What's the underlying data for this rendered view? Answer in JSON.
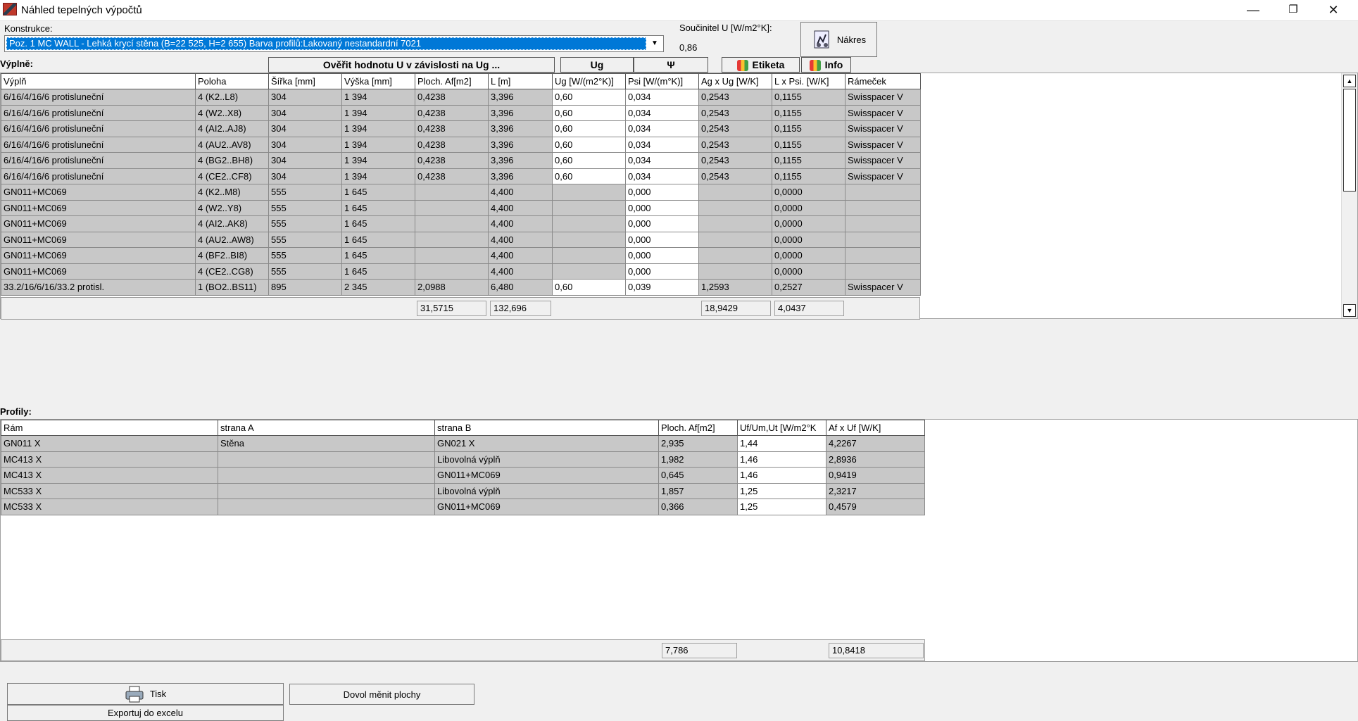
{
  "window": {
    "title": "Náhled tepelných výpočtů",
    "minimize": "—",
    "restore": "❐",
    "close": "✕"
  },
  "konstrukce": {
    "label": "Konstrukce:",
    "selected": "Poz. 1  MC WALL - Lehká krycí stěna (B=22 525, H=2 655) Barva profilů:Lakovaný nestandardní 7021"
  },
  "u_value": {
    "label": "Součinitel U [W/m2°K]:",
    "value": "0,86"
  },
  "buttons": {
    "nakres": "Nákres",
    "overit": "Ověřit hodnotu U v závislosti na Ug ...",
    "ug": "Ug",
    "psi": "Ψ",
    "etiketa": "Etiketa",
    "info": "Info",
    "tisk": "Tisk",
    "dovol": "Dovol měnit plochy",
    "export": "Exportuj do excelu"
  },
  "fills": {
    "section_label": "Výplně:",
    "columns": [
      "Výplň",
      "Poloha",
      "Šířka [mm]",
      "Výška [mm]",
      "Ploch. Af[m2]",
      "L [m]",
      "Ug [W/(m2°K)]",
      "Psi [W/(m°K)]",
      "Ag x Ug [W/K]",
      "L x Psi. [W/K]",
      "Rámeček"
    ],
    "rows": [
      [
        "6/16/4/16/6 protisluneční",
        "4 (K2..L8)",
        "304",
        "1 394",
        "0,4238",
        "3,396",
        "0,60",
        "0,034",
        "0,2543",
        "0,1155",
        "Swisspacer V"
      ],
      [
        "6/16/4/16/6 protisluneční",
        "4 (W2..X8)",
        "304",
        "1 394",
        "0,4238",
        "3,396",
        "0,60",
        "0,034",
        "0,2543",
        "0,1155",
        "Swisspacer V"
      ],
      [
        "6/16/4/16/6 protisluneční",
        "4 (AI2..AJ8)",
        "304",
        "1 394",
        "0,4238",
        "3,396",
        "0,60",
        "0,034",
        "0,2543",
        "0,1155",
        "Swisspacer V"
      ],
      [
        "6/16/4/16/6 protisluneční",
        "4 (AU2..AV8)",
        "304",
        "1 394",
        "0,4238",
        "3,396",
        "0,60",
        "0,034",
        "0,2543",
        "0,1155",
        "Swisspacer V"
      ],
      [
        "6/16/4/16/6 protisluneční",
        "4 (BG2..BH8)",
        "304",
        "1 394",
        "0,4238",
        "3,396",
        "0,60",
        "0,034",
        "0,2543",
        "0,1155",
        "Swisspacer V"
      ],
      [
        "6/16/4/16/6 protisluneční",
        "4 (CE2..CF8)",
        "304",
        "1 394",
        "0,4238",
        "3,396",
        "0,60",
        "0,034",
        "0,2543",
        "0,1155",
        "Swisspacer V"
      ],
      [
        "GN011+MC069",
        "4 (K2..M8)",
        "555",
        "1 645",
        "",
        "4,400",
        "",
        "0,000",
        "",
        "0,0000",
        ""
      ],
      [
        "GN011+MC069",
        "4 (W2..Y8)",
        "555",
        "1 645",
        "",
        "4,400",
        "",
        "0,000",
        "",
        "0,0000",
        ""
      ],
      [
        "GN011+MC069",
        "4 (AI2..AK8)",
        "555",
        "1 645",
        "",
        "4,400",
        "",
        "0,000",
        "",
        "0,0000",
        ""
      ],
      [
        "GN011+MC069",
        "4 (AU2..AW8)",
        "555",
        "1 645",
        "",
        "4,400",
        "",
        "0,000",
        "",
        "0,0000",
        ""
      ],
      [
        "GN011+MC069",
        "4 (BF2..BI8)",
        "555",
        "1 645",
        "",
        "4,400",
        "",
        "0,000",
        "",
        "0,0000",
        ""
      ],
      [
        "GN011+MC069",
        "4 (CE2..CG8)",
        "555",
        "1 645",
        "",
        "4,400",
        "",
        "0,000",
        "",
        "0,0000",
        ""
      ],
      [
        "33.2/16/6/16/33.2 protisl.",
        "1 (BO2..BS11)",
        "895",
        "2 345",
        "2,0988",
        "6,480",
        "0,60",
        "0,039",
        "1,2593",
        "0,2527",
        "Swisspacer V"
      ]
    ],
    "totals": {
      "area": "31,5715",
      "length": "132,696",
      "agug": "18,9429",
      "lpsi": "4,0437"
    }
  },
  "profiles": {
    "section_label": "Profily:",
    "columns": [
      "Rám",
      "strana A",
      "strana B",
      "Ploch. Af[m2]",
      "Uf/Um,Ut [W/m2°K",
      "Af x Uf [W/K]"
    ],
    "rows": [
      [
        "GN011 X",
        "Stěna",
        "GN021 X",
        "2,935",
        "1,44",
        "4,2267"
      ],
      [
        "MC413 X",
        "",
        "Libovolná výplň",
        "1,982",
        "1,46",
        "2,8936"
      ],
      [
        "MC413 X",
        "",
        "GN011+MC069",
        "0,645",
        "1,46",
        "0,9419"
      ],
      [
        "MC533 X",
        "",
        "Libovolná výplň",
        "1,857",
        "1,25",
        "2,3217"
      ],
      [
        "MC533 X",
        "",
        "GN011+MC069",
        "0,366",
        "1,25",
        "0,4579"
      ]
    ],
    "totals": {
      "area": "7,786",
      "afuf": "10,8418"
    }
  }
}
